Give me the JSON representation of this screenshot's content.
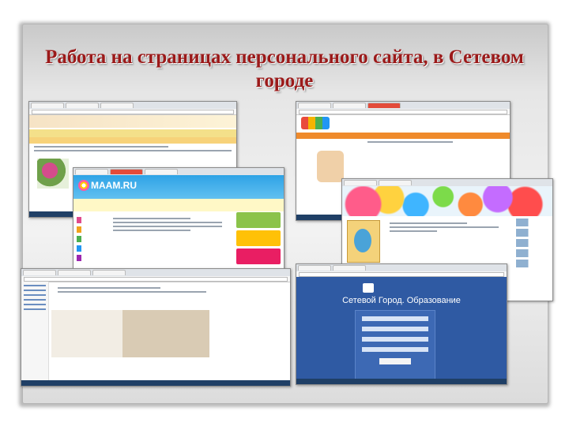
{
  "slide": {
    "title": "Работа на страницах персонального сайта, в Сетевом городе"
  },
  "screenshots": {
    "maam": {
      "logo": "MAAM.RU"
    },
    "netcity": {
      "title": "Сетевой Город. Образование"
    }
  }
}
